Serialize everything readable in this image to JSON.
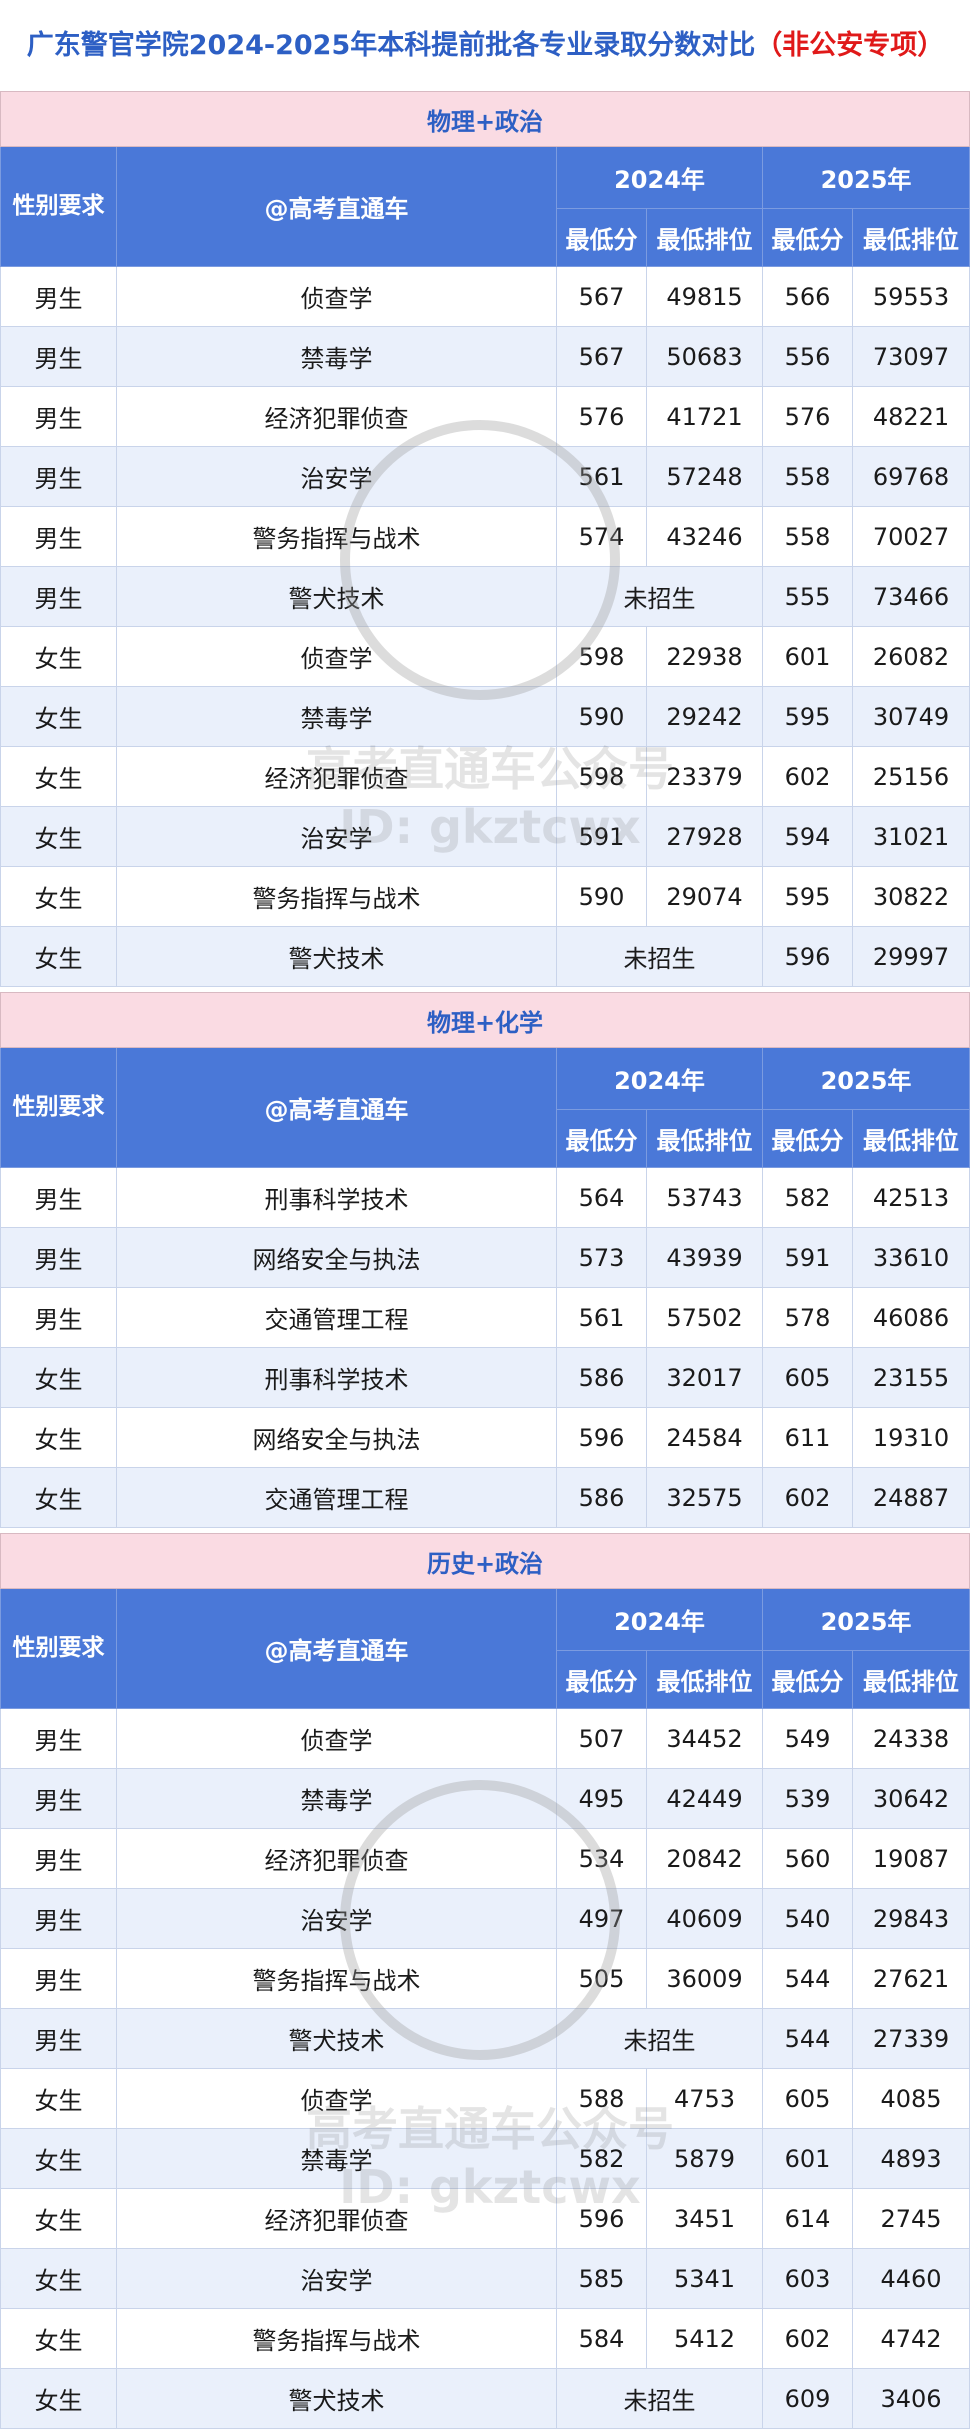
{
  "title": "广东警官学院2024-2025年本科提前批各专业录取分数对比",
  "title_tag": "（非公安专项）",
  "watermark": {
    "line1": "高考直通车公众号",
    "line2": "ID: gkztcwx"
  },
  "colors": {
    "title": "#2d5fc4",
    "title_tag": "#e01919",
    "section_bg": "#fadbe3",
    "header_bg": "#4a78d8",
    "row_alt": "#eaf0fb"
  },
  "sections": [
    {
      "title": "物理+政治",
      "header": {
        "gender": "性别要求",
        "major": "@高考直通车",
        "year1": "2024年",
        "year2": "2025年",
        "min_score": "最低分",
        "min_rank": "最低排位"
      },
      "rows": [
        {
          "gender": "男生",
          "major": "侦查学",
          "s2024": "567",
          "r2024": "49815",
          "s2025": "566",
          "r2025": "59553"
        },
        {
          "gender": "男生",
          "major": "禁毒学",
          "s2024": "567",
          "r2024": "50683",
          "s2025": "556",
          "r2025": "73097"
        },
        {
          "gender": "男生",
          "major": "经济犯罪侦查",
          "s2024": "576",
          "r2024": "41721",
          "s2025": "576",
          "r2025": "48221"
        },
        {
          "gender": "男生",
          "major": "治安学",
          "s2024": "561",
          "r2024": "57248",
          "s2025": "558",
          "r2025": "69768"
        },
        {
          "gender": "男生",
          "major": "警务指挥与战术",
          "s2024": "574",
          "r2024": "43246",
          "s2025": "558",
          "r2025": "70027"
        },
        {
          "gender": "男生",
          "major": "警犬技术",
          "merged2024": "未招生",
          "s2025": "555",
          "r2025": "73466"
        },
        {
          "gender": "女生",
          "major": "侦查学",
          "s2024": "598",
          "r2024": "22938",
          "s2025": "601",
          "r2025": "26082"
        },
        {
          "gender": "女生",
          "major": "禁毒学",
          "s2024": "590",
          "r2024": "29242",
          "s2025": "595",
          "r2025": "30749"
        },
        {
          "gender": "女生",
          "major": "经济犯罪侦查",
          "s2024": "598",
          "r2024": "23379",
          "s2025": "602",
          "r2025": "25156"
        },
        {
          "gender": "女生",
          "major": "治安学",
          "s2024": "591",
          "r2024": "27928",
          "s2025": "594",
          "r2025": "31021"
        },
        {
          "gender": "女生",
          "major": "警务指挥与战术",
          "s2024": "590",
          "r2024": "29074",
          "s2025": "595",
          "r2025": "30822"
        },
        {
          "gender": "女生",
          "major": "警犬技术",
          "merged2024": "未招生",
          "s2025": "596",
          "r2025": "29997"
        }
      ]
    },
    {
      "title": "物理+化学",
      "header": {
        "gender": "性别要求",
        "major": "@高考直通车",
        "year1": "2024年",
        "year2": "2025年",
        "min_score": "最低分",
        "min_rank": "最低排位"
      },
      "rows": [
        {
          "gender": "男生",
          "major": "刑事科学技术",
          "s2024": "564",
          "r2024": "53743",
          "s2025": "582",
          "r2025": "42513"
        },
        {
          "gender": "男生",
          "major": "网络安全与执法",
          "s2024": "573",
          "r2024": "43939",
          "s2025": "591",
          "r2025": "33610"
        },
        {
          "gender": "男生",
          "major": "交通管理工程",
          "s2024": "561",
          "r2024": "57502",
          "s2025": "578",
          "r2025": "46086"
        },
        {
          "gender": "女生",
          "major": "刑事科学技术",
          "s2024": "586",
          "r2024": "32017",
          "s2025": "605",
          "r2025": "23155"
        },
        {
          "gender": "女生",
          "major": "网络安全与执法",
          "s2024": "596",
          "r2024": "24584",
          "s2025": "611",
          "r2025": "19310"
        },
        {
          "gender": "女生",
          "major": "交通管理工程",
          "s2024": "586",
          "r2024": "32575",
          "s2025": "602",
          "r2025": "24887"
        }
      ]
    },
    {
      "title": "历史+政治",
      "header": {
        "gender": "性别要求",
        "major": "@高考直通车",
        "year1": "2024年",
        "year2": "2025年",
        "min_score": "最低分",
        "min_rank": "最低排位"
      },
      "rows": [
        {
          "gender": "男生",
          "major": "侦查学",
          "s2024": "507",
          "r2024": "34452",
          "s2025": "549",
          "r2025": "24338"
        },
        {
          "gender": "男生",
          "major": "禁毒学",
          "s2024": "495",
          "r2024": "42449",
          "s2025": "539",
          "r2025": "30642"
        },
        {
          "gender": "男生",
          "major": "经济犯罪侦查",
          "s2024": "534",
          "r2024": "20842",
          "s2025": "560",
          "r2025": "19087"
        },
        {
          "gender": "男生",
          "major": "治安学",
          "s2024": "497",
          "r2024": "40609",
          "s2025": "540",
          "r2025": "29843"
        },
        {
          "gender": "男生",
          "major": "警务指挥与战术",
          "s2024": "505",
          "r2024": "36009",
          "s2025": "544",
          "r2025": "27621"
        },
        {
          "gender": "男生",
          "major": "警犬技术",
          "merged2024": "未招生",
          "s2025": "544",
          "r2025": "27339"
        },
        {
          "gender": "女生",
          "major": "侦查学",
          "s2024": "588",
          "r2024": "4753",
          "s2025": "605",
          "r2025": "4085"
        },
        {
          "gender": "女生",
          "major": "禁毒学",
          "s2024": "582",
          "r2024": "5879",
          "s2025": "601",
          "r2025": "4893"
        },
        {
          "gender": "女生",
          "major": "经济犯罪侦查",
          "s2024": "596",
          "r2024": "3451",
          "s2025": "614",
          "r2025": "2745"
        },
        {
          "gender": "女生",
          "major": "治安学",
          "s2024": "585",
          "r2024": "5341",
          "s2025": "603",
          "r2025": "4460"
        },
        {
          "gender": "女生",
          "major": "警务指挥与战术",
          "s2024": "584",
          "r2024": "5412",
          "s2025": "602",
          "r2025": "4742"
        },
        {
          "gender": "女生",
          "major": "警犬技术",
          "merged2024": "未招生",
          "s2025": "609",
          "r2025": "3406"
        }
      ]
    }
  ]
}
